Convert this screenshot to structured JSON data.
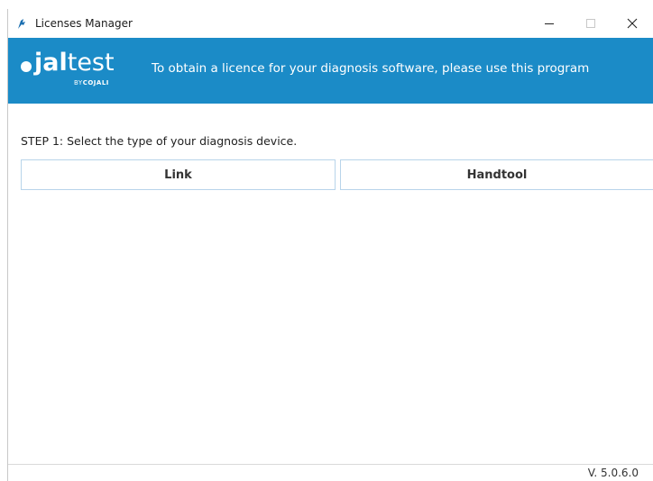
{
  "window": {
    "title": "Licenses Manager",
    "app_icon": "jaltest-app-icon",
    "controls": {
      "minimize_icon": "minimize-icon",
      "maximize_icon": "maximize-icon",
      "close_icon": "close-icon"
    }
  },
  "banner": {
    "logo_prefix": "jal",
    "logo_suffix": "test",
    "logo_by": "BY",
    "logo_company": "COJALI",
    "message": "To obtain a licence for your diagnosis software, please use this program",
    "background_color": "#1b8bc7"
  },
  "step": {
    "label": "STEP 1: Select the type of your diagnosis device."
  },
  "devices": {
    "link_label": "Link",
    "handtool_label": "Handtool"
  },
  "status": {
    "version": "V. 5.0.6.0"
  }
}
